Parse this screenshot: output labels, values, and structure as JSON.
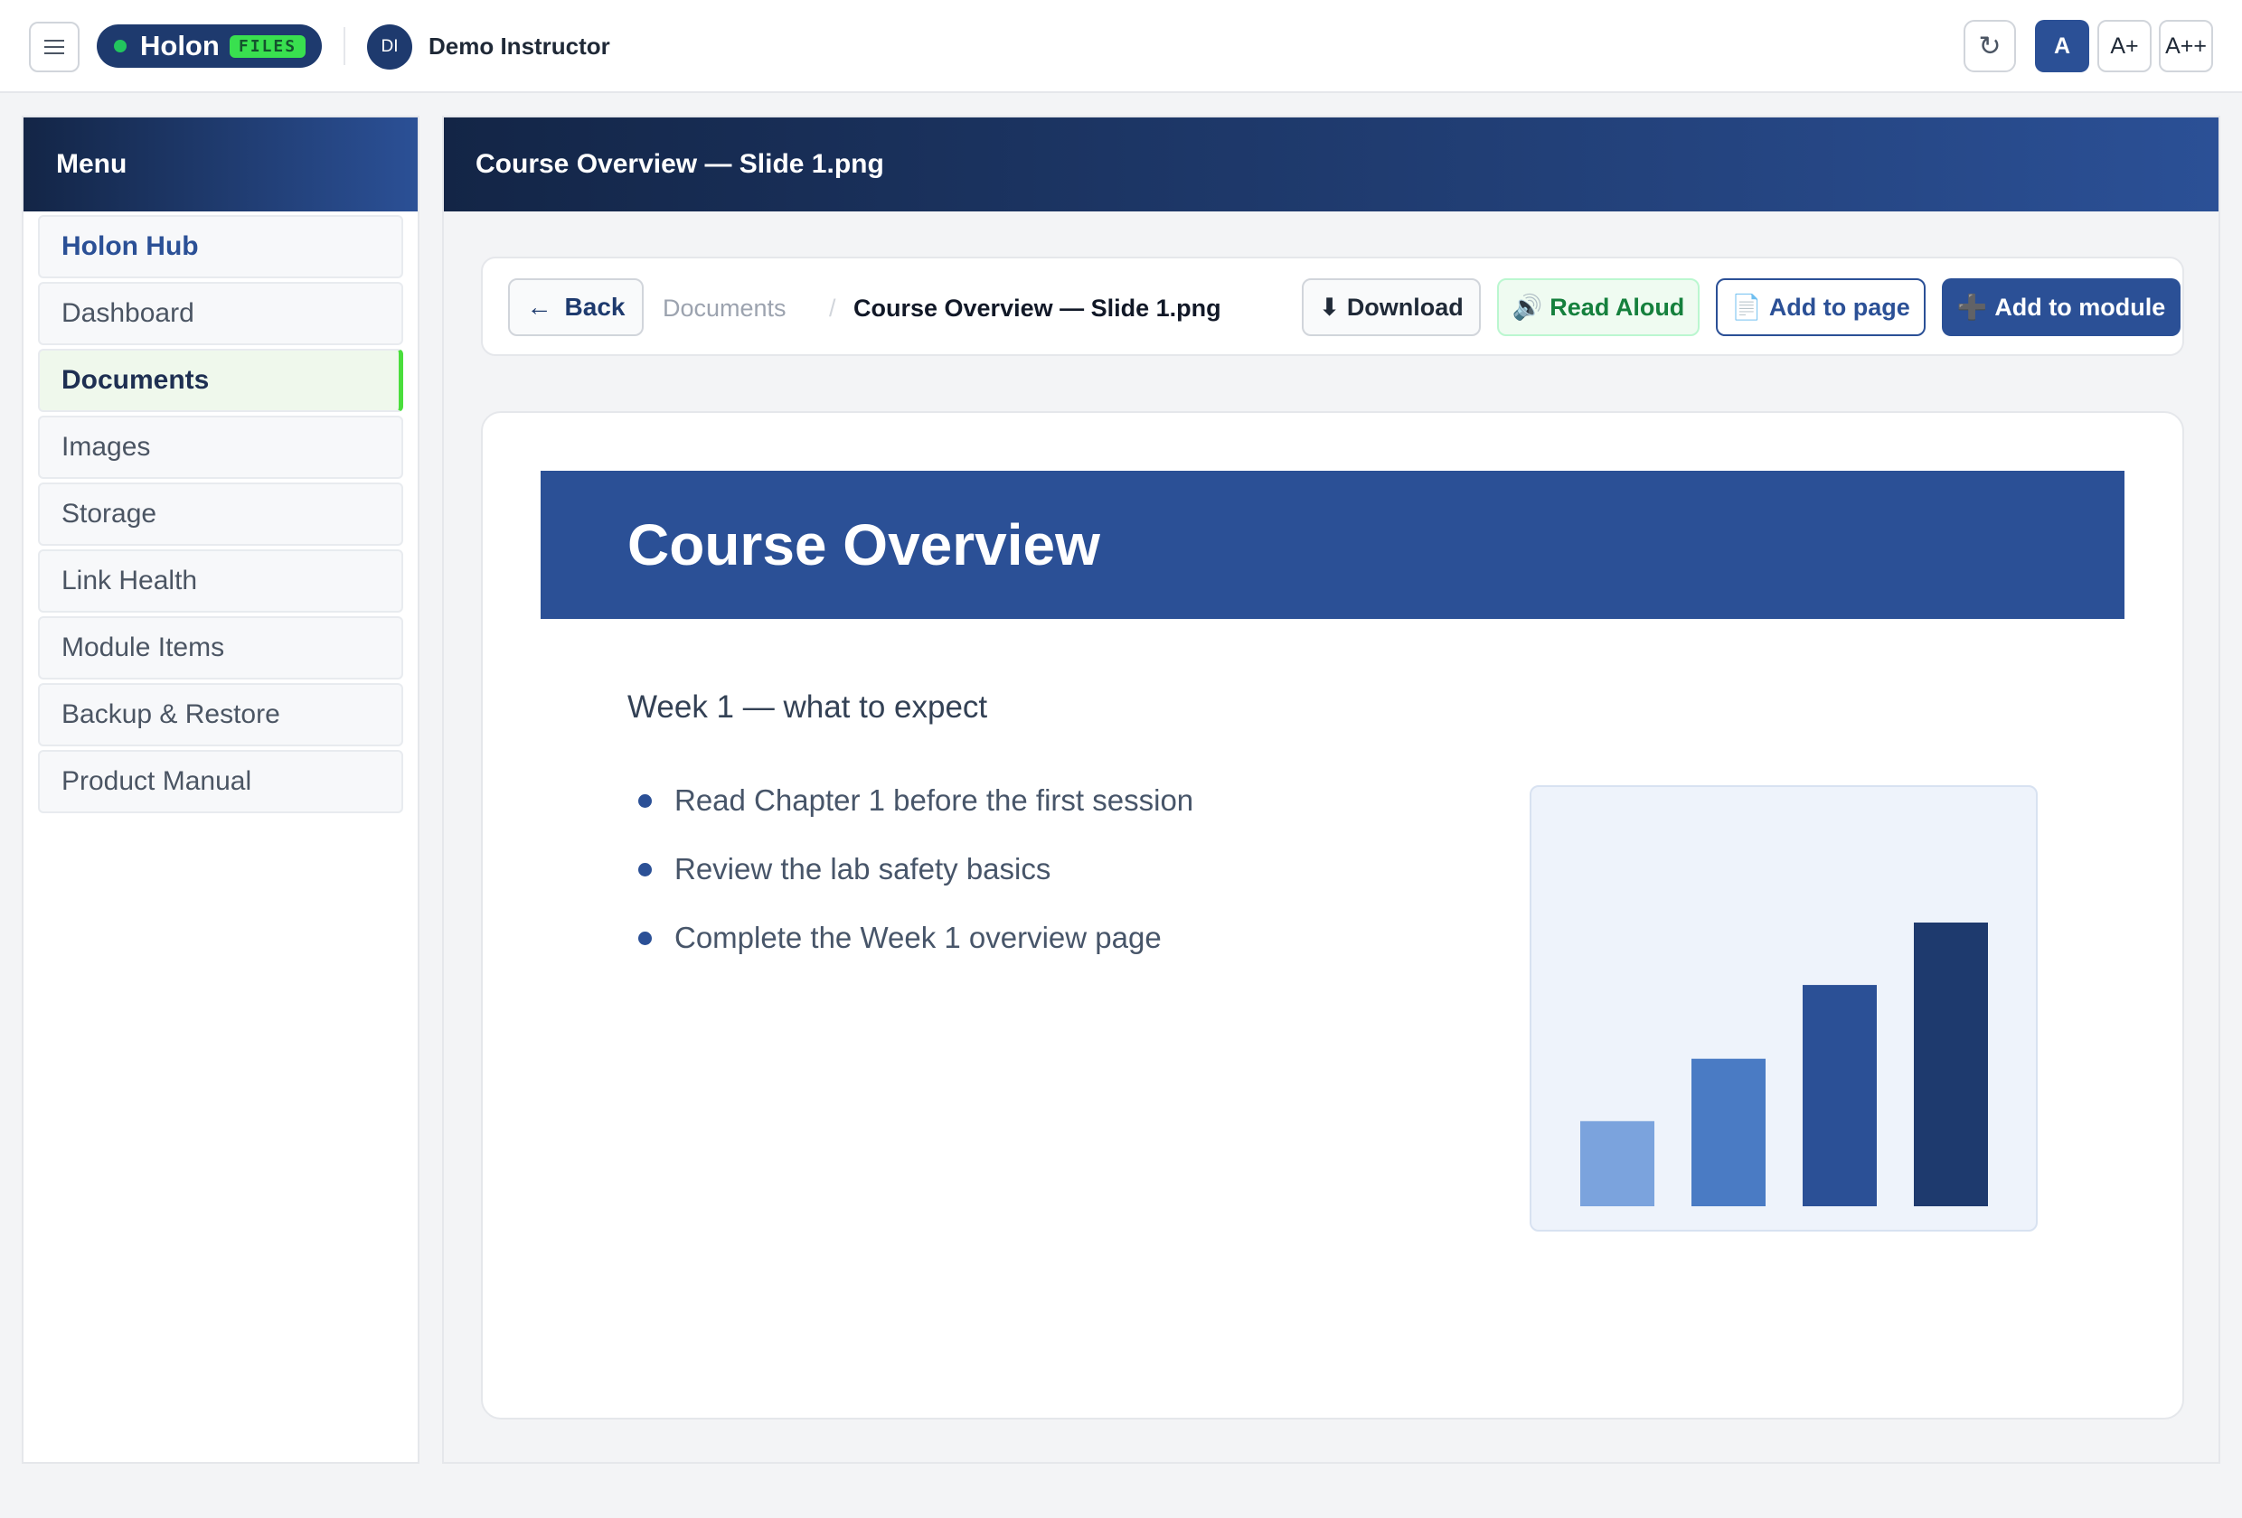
{
  "topbar": {
    "menu_icon": "hamburger-icon",
    "brand": "Holon",
    "brand_badge": "FILES",
    "user_initials": "DI",
    "user_name": "Demo Instructor",
    "refresh_icon": "↻",
    "font_sizes": [
      "A",
      "A+",
      "A++"
    ],
    "accent": "#2b5096"
  },
  "sidebar": {
    "title": "Menu",
    "items": [
      {
        "label": "Holon Hub"
      },
      {
        "label": "Dashboard"
      },
      {
        "label": "Documents"
      },
      {
        "label": "Images"
      },
      {
        "label": "Storage"
      },
      {
        "label": "Link Health"
      },
      {
        "label": "Module Items"
      },
      {
        "label": "Backup & Restore"
      },
      {
        "label": "Product Manual"
      }
    ],
    "active_index": 2
  },
  "main": {
    "header_title": "Course Overview — Slide 1.png",
    "toolbar": {
      "back_icon": "←",
      "back_label": "Back",
      "breadcrumb_root": "Documents",
      "breadcrumb_sep": "/",
      "breadcrumb_current": "Course Overview — Slide 1.png",
      "download_icon": "⬇",
      "download_label": "Download",
      "read_aloud_icon": "🔊",
      "read_aloud_label": "Read Aloud",
      "add_page_icon": "📄",
      "add_page_label": "Add to page",
      "add_module_icon": "➕",
      "add_module_label": "Add to module"
    },
    "slide": {
      "title": "Course Overview",
      "subtitle": "Week 1 — what to expect",
      "bullets": [
        "Read Chapter 1 before the first session",
        "Review the lab safety basics",
        "Complete the Week 1 overview page"
      ]
    }
  },
  "chart_data": {
    "type": "bar",
    "categories": [
      "",
      "",
      "",
      ""
    ],
    "values": [
      30,
      52,
      78,
      100
    ],
    "colors": [
      "#7ba3dd",
      "#4a7bc4",
      "#2b5096",
      "#1e3a6e"
    ],
    "ylim": [
      0,
      100
    ],
    "grid": false,
    "title": "",
    "xlabel": "",
    "ylabel": ""
  }
}
